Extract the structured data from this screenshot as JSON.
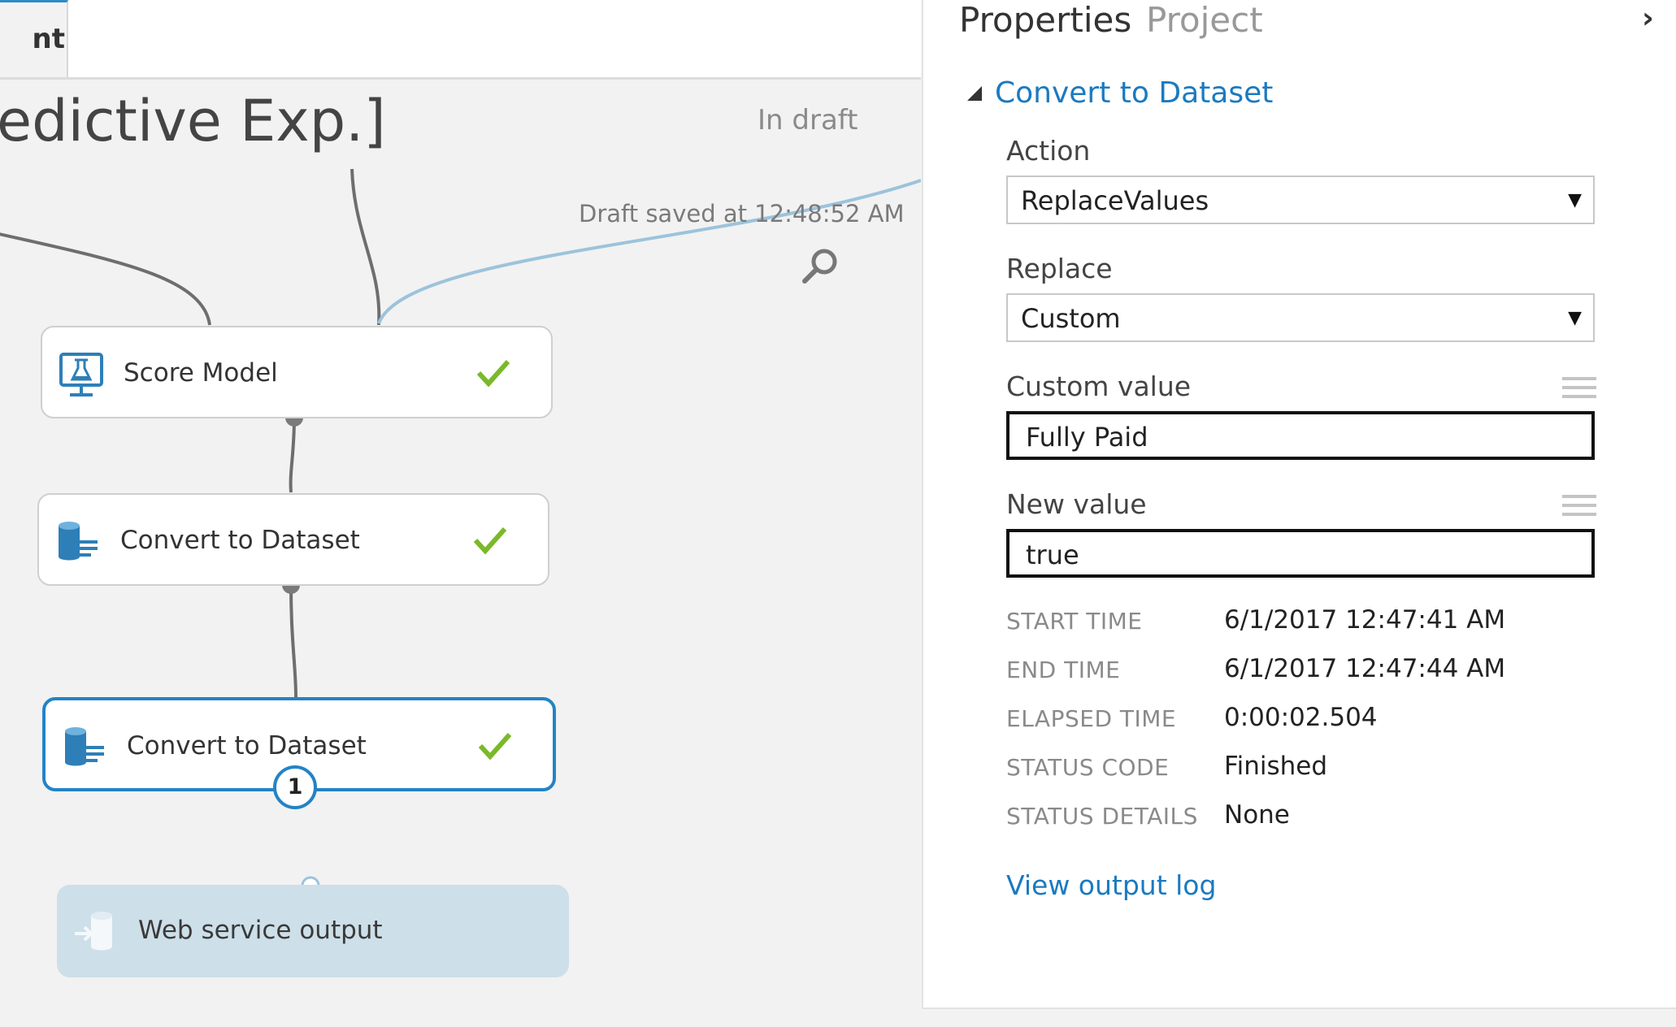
{
  "canvas": {
    "tab_label": "nt",
    "experiment_title": "edictive Exp.]",
    "draft_status": "In draft",
    "draft_saved": "Draft saved at 12:48:52 AM",
    "nodes": [
      {
        "label": "Score Model",
        "icon": "score-model-icon",
        "status": "check-icon"
      },
      {
        "label": "Convert to Dataset",
        "icon": "dataset-icon",
        "status": "check-icon"
      },
      {
        "label": "Convert to Dataset",
        "icon": "dataset-icon",
        "status": "check-icon",
        "badge": "1",
        "selected": true
      },
      {
        "label": "Web service output",
        "icon": "web-service-output-icon"
      }
    ]
  },
  "panel": {
    "tabs": {
      "properties": "Properties",
      "project": "Project"
    },
    "collapse_icon": "chevron-right-icon",
    "section_title": "Convert to Dataset",
    "fields": {
      "action": {
        "label": "Action",
        "value": "ReplaceValues"
      },
      "replace": {
        "label": "Replace",
        "value": "Custom"
      },
      "custom_value": {
        "label": "Custom value",
        "value": "Fully Paid"
      },
      "new_value": {
        "label": "New value",
        "value": "true"
      }
    },
    "run_info": [
      {
        "key": "START TIME",
        "value": "6/1/2017 12:47:41 AM"
      },
      {
        "key": "END TIME",
        "value": "6/1/2017 12:47:44 AM"
      },
      {
        "key": "ELAPSED TIME",
        "value": "0:00:02.504"
      },
      {
        "key": "STATUS CODE",
        "value": "Finished"
      },
      {
        "key": "STATUS DETAILS",
        "value": "None"
      }
    ],
    "view_output_log": "View output log"
  },
  "colors": {
    "accent": "#1a7ac0",
    "selected_border": "#2483c5",
    "success": "#7ab929",
    "web_output_bg": "#cddfe9",
    "edge": "#6e6e6e",
    "web_edge": "#9cc3db"
  }
}
